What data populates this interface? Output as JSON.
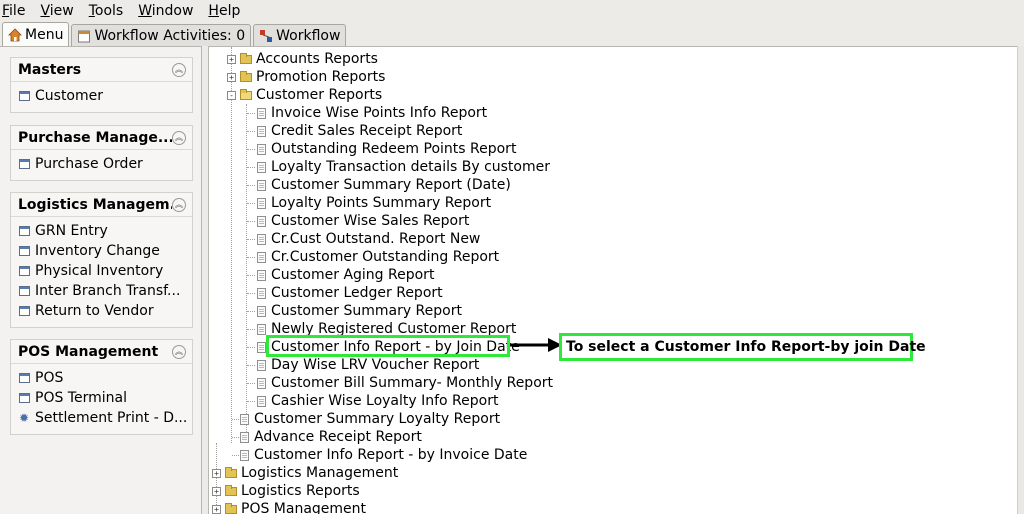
{
  "menubar": {
    "items": [
      {
        "mnemonic": "F",
        "rest": "ile"
      },
      {
        "mnemonic": "V",
        "rest": "iew"
      },
      {
        "mnemonic": "T",
        "rest": "ools"
      },
      {
        "mnemonic": "W",
        "rest": "indow"
      },
      {
        "mnemonic": "H",
        "rest": "elp"
      }
    ]
  },
  "tabs": [
    {
      "label": "Menu",
      "icon": "home-icon",
      "active": true
    },
    {
      "label": "Workflow Activities: 0",
      "icon": "calendar-icon",
      "active": false
    },
    {
      "label": "Workflow",
      "icon": "workflow-icon",
      "active": false
    }
  ],
  "sidebar": {
    "sections": [
      {
        "title": "Masters",
        "items": [
          {
            "label": "Customer",
            "icon": "window-icon"
          }
        ]
      },
      {
        "title": "Purchase Manage...",
        "items": [
          {
            "label": "Purchase Order",
            "icon": "window-icon"
          }
        ]
      },
      {
        "title": "Logistics Managem...",
        "items": [
          {
            "label": "GRN Entry",
            "icon": "window-icon"
          },
          {
            "label": "Inventory Change",
            "icon": "window-icon"
          },
          {
            "label": "Physical Inventory",
            "icon": "window-icon"
          },
          {
            "label": "Inter Branch Transf...",
            "icon": "window-icon"
          },
          {
            "label": "Return to Vendor",
            "icon": "window-icon"
          }
        ]
      },
      {
        "title": "POS Management",
        "items": [
          {
            "label": "POS",
            "icon": "window-icon"
          },
          {
            "label": "POS Terminal",
            "icon": "window-icon"
          },
          {
            "label": "Settlement Print - D...",
            "icon": "gear-icon"
          }
        ]
      }
    ]
  },
  "tree": {
    "rows": [
      {
        "label": "Accounts Reports",
        "type": "folder",
        "level": 1,
        "expander": "+"
      },
      {
        "label": "Promotion Reports",
        "type": "folder",
        "level": 1,
        "expander": "+"
      },
      {
        "label": "Customer Reports",
        "type": "folder-open",
        "level": 1,
        "expander": "-"
      },
      {
        "label": "Invoice Wise Points Info Report",
        "type": "doc",
        "level": 2
      },
      {
        "label": "Credit Sales Receipt Report",
        "type": "doc",
        "level": 2
      },
      {
        "label": "Outstanding Redeem Points Report",
        "type": "doc",
        "level": 2
      },
      {
        "label": "Loyalty Transaction details By customer",
        "type": "doc",
        "level": 2
      },
      {
        "label": "Customer Summary Report (Date)",
        "type": "doc",
        "level": 2
      },
      {
        "label": "Loyalty Points Summary Report",
        "type": "doc",
        "level": 2
      },
      {
        "label": "Customer Wise Sales Report",
        "type": "doc",
        "level": 2
      },
      {
        "label": "Cr.Cust Outstand. Report New",
        "type": "doc",
        "level": 2
      },
      {
        "label": "Cr.Customer Outstanding Report",
        "type": "doc",
        "level": 2
      },
      {
        "label": "Customer Aging Report",
        "type": "doc",
        "level": 2
      },
      {
        "label": "Customer Ledger Report",
        "type": "doc",
        "level": 2
      },
      {
        "label": "Customer Summary Report",
        "type": "doc",
        "level": 2
      },
      {
        "label": "Newly Registered Customer Report",
        "type": "doc",
        "level": 2
      },
      {
        "label": "Customer Info Report - by Join Date",
        "type": "doc",
        "level": 2,
        "highlighted": true
      },
      {
        "label": "Day Wise LRV Voucher Report",
        "type": "doc",
        "level": 2
      },
      {
        "label": "Customer Bill Summary- Monthly Report",
        "type": "doc",
        "level": 2
      },
      {
        "label": "Cashier Wise Loyalty Info Report",
        "type": "doc",
        "level": 2
      },
      {
        "label": "Customer Summary Loyalty Report",
        "type": "doc",
        "level": 1
      },
      {
        "label": "Advance Receipt Report",
        "type": "doc",
        "level": 1
      },
      {
        "label": "Customer Info Report - by Invoice Date",
        "type": "doc",
        "level": 1
      },
      {
        "label": "Logistics Management",
        "type": "folder",
        "level": 0,
        "expander": "+"
      },
      {
        "label": "Logistics Reports",
        "type": "folder",
        "level": 0,
        "expander": "+"
      },
      {
        "label": "POS Management",
        "type": "folder",
        "level": 0,
        "expander": "+"
      }
    ]
  },
  "annotation": {
    "callout_text": "To select a Customer Info Report-by join Date",
    "highlight_color": "#2ee83a"
  }
}
